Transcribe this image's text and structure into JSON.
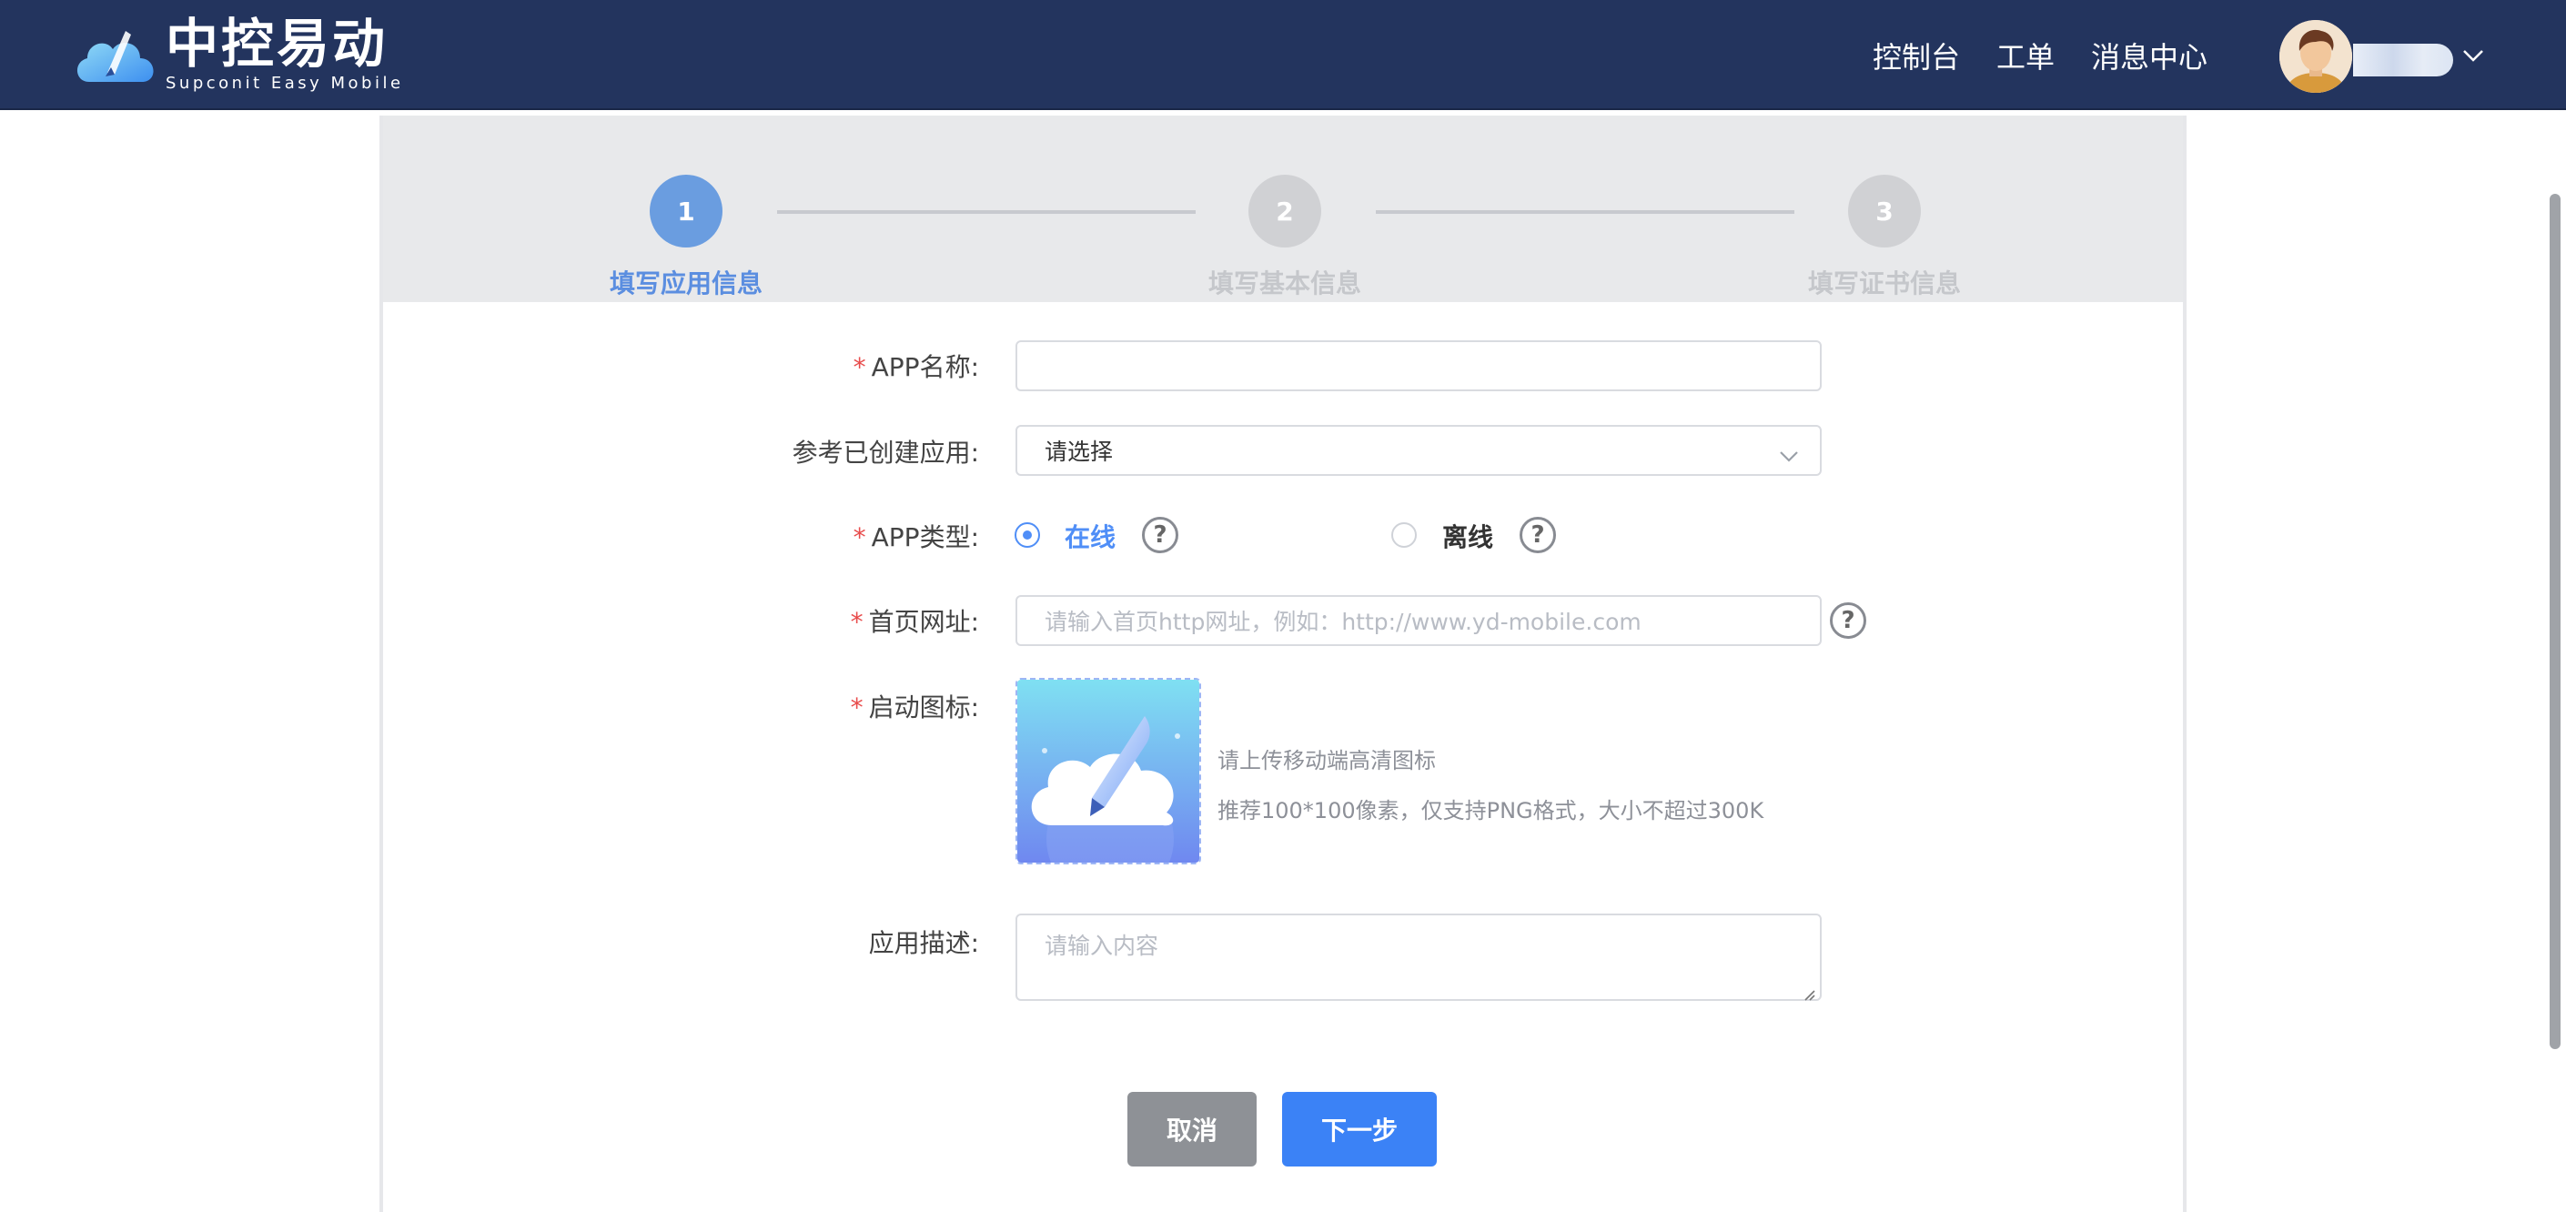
{
  "header": {
    "logo_title": "中控易动",
    "logo_subtitle": "Supconit Easy Mobile",
    "nav": [
      {
        "label": "控制台"
      },
      {
        "label": "工单"
      },
      {
        "label": "消息中心"
      }
    ]
  },
  "steps": [
    {
      "number": "1",
      "label": "填写应用信息",
      "state": "active"
    },
    {
      "number": "2",
      "label": "填写基本信息",
      "state": "inactive"
    },
    {
      "number": "3",
      "label": "填写证书信息",
      "state": "inactive"
    }
  ],
  "form": {
    "required_mark": "*",
    "app_name": {
      "label": "APP名称:",
      "value": ""
    },
    "reference_app": {
      "label": "参考已创建应用:",
      "value": "请选择"
    },
    "app_type": {
      "label": "APP类型:",
      "options": [
        {
          "label": "在线",
          "checked": true
        },
        {
          "label": "离线",
          "checked": false
        }
      ]
    },
    "homepage_url": {
      "label": "首页网址:",
      "placeholder": "请输入首页http网址，例如：http://www.yd-mobile.com"
    },
    "launch_icon": {
      "label": "启动图标:",
      "hint_1": "请上传移动端高清图标",
      "hint_2": "推荐100*100像素，仅支持PNG格式，大小不超过300K"
    },
    "description": {
      "label": "应用描述:",
      "placeholder": "请输入内容"
    },
    "help_glyph": "?"
  },
  "buttons": {
    "cancel": "取消",
    "next": "下一步"
  },
  "colors": {
    "header_bg": "#23345e",
    "primary": "#3b82f6",
    "step_active": "#6a9de0",
    "required": "#e84c4c"
  }
}
